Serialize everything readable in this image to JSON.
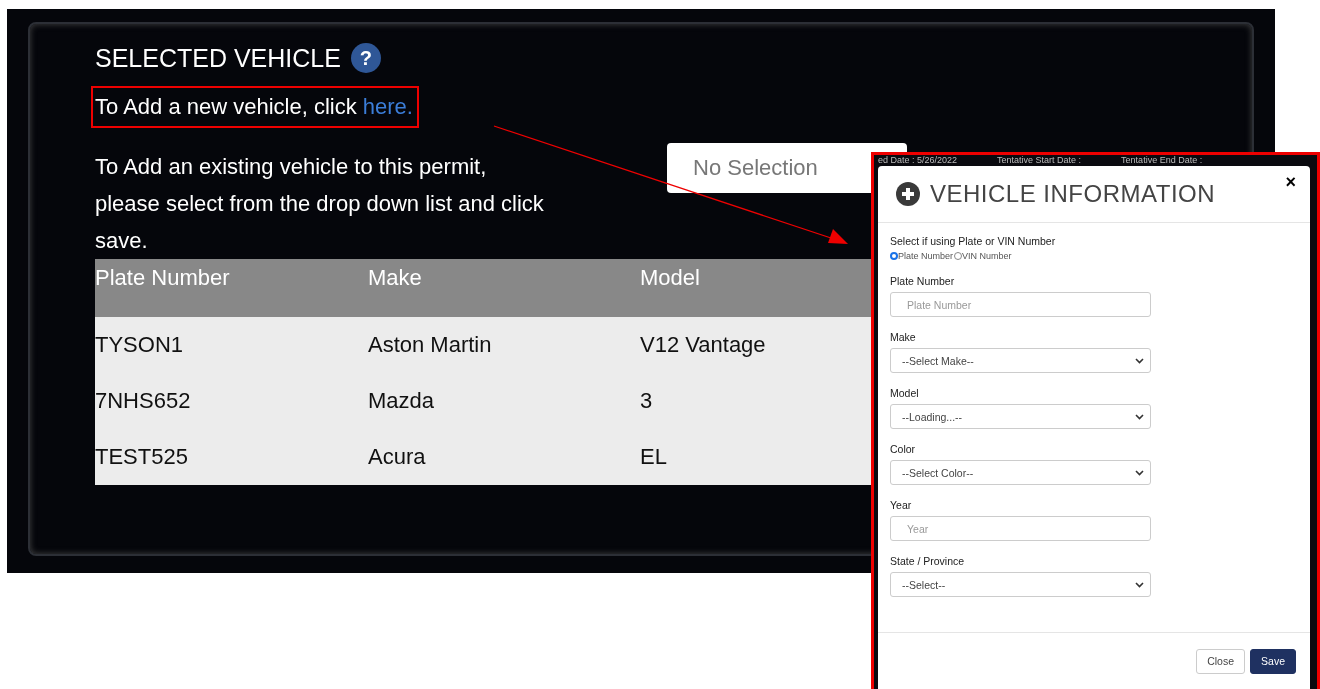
{
  "panel": {
    "title": "SELECTED VEHICLE",
    "help_icon": "?",
    "add_new_text": "To Add a new vehicle, click",
    "add_new_link": "here.",
    "existing_text": "To Add an existing vehicle to this permit, please select from the drop down list and click save.",
    "vehicle_select": {
      "value": "No Selection"
    }
  },
  "table": {
    "columns": [
      "Plate Number",
      "Make",
      "Model"
    ],
    "rows": [
      [
        "TYSON1",
        "Aston Martin",
        "V12 Vantage"
      ],
      [
        "7NHS652",
        "Mazda",
        "3"
      ],
      [
        "TEST525",
        "Acura",
        "EL"
      ]
    ]
  },
  "background_strip": [
    "ed Date : 5/26/2022",
    "Tentative Start Date :",
    "Tentative End Date :"
  ],
  "modal": {
    "title": "VEHICLE INFORMATION",
    "close": "×",
    "radio_group": {
      "label": "Select if using Plate or VIN Number",
      "options": [
        {
          "label": "Plate Number",
          "selected": true
        },
        {
          "label": "VIN Number",
          "selected": false
        }
      ]
    },
    "fields": [
      {
        "label": "Plate Number",
        "kind": "input",
        "placeholder": "Plate Number"
      },
      {
        "label": "Make",
        "kind": "select",
        "value": "--Select Make--"
      },
      {
        "label": "Model",
        "kind": "select",
        "value": "--Loading...--"
      },
      {
        "label": "Color",
        "kind": "select",
        "value": "--Select Color--"
      },
      {
        "label": "Year",
        "kind": "input",
        "placeholder": "Year"
      },
      {
        "label": "State / Province",
        "kind": "select",
        "value": "--Select--"
      }
    ],
    "buttons": [
      {
        "label": "Close",
        "kind": "secondary"
      },
      {
        "label": "Save",
        "kind": "primary"
      }
    ]
  }
}
